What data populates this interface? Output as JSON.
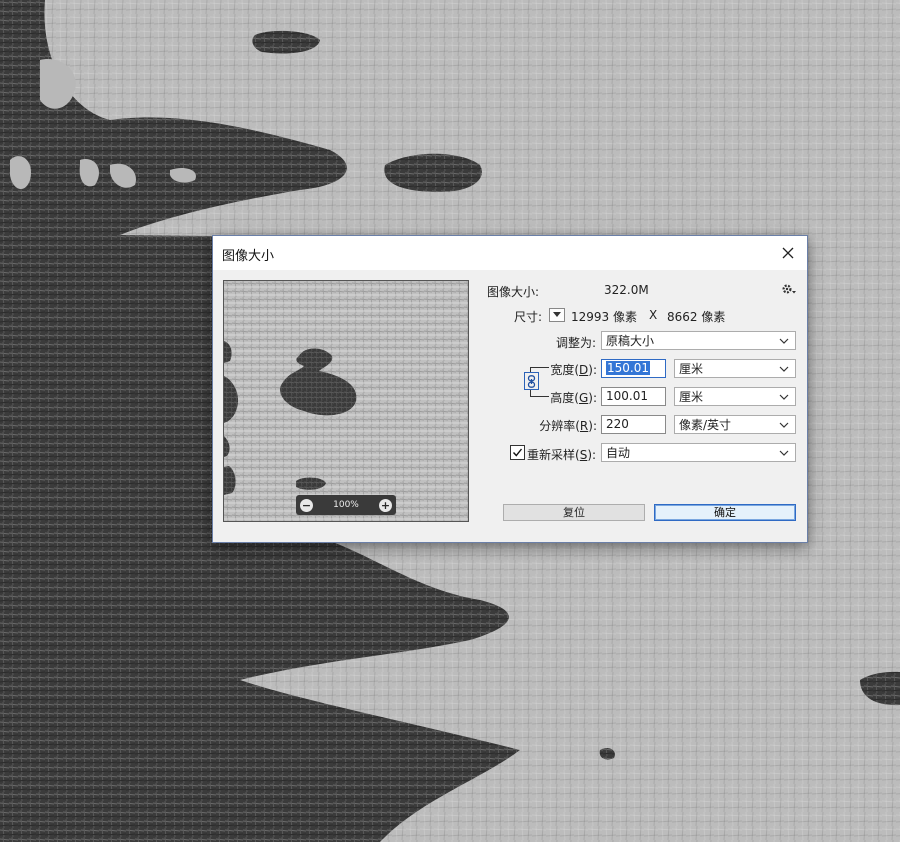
{
  "dialog": {
    "title": "图像大小",
    "close_icon": "close-icon"
  },
  "preview": {
    "zoom_level": "100%",
    "zoom_out_icon": "minus-icon",
    "zoom_in_icon": "plus-icon"
  },
  "info": {
    "image_size_label": "图像大小:",
    "image_size_value": "322.0M",
    "dimensions_label": "尺寸:",
    "dimensions_width": "12993 像素",
    "dimensions_x": "X",
    "dimensions_height": "8662 像素",
    "settings_icon": "gear-icon"
  },
  "fit_to": {
    "label": "调整为:",
    "value": "原稿大小"
  },
  "width": {
    "label_main": "宽度(",
    "label_key": "D",
    "label_end": "):",
    "value": "150.01",
    "unit": "厘米"
  },
  "height": {
    "label_main": "高度(",
    "label_key": "G",
    "label_end": "):",
    "value": "100.01",
    "unit": "厘米"
  },
  "resolution": {
    "label_main": "分辨率(",
    "label_key": "R",
    "label_end": "):",
    "value": "220",
    "unit": "像素/英寸"
  },
  "resample": {
    "checked": true,
    "label_main": "重新采样(",
    "label_key": "S",
    "label_end": "):",
    "value": "自动"
  },
  "buttons": {
    "reset": "复位",
    "ok": "确定"
  },
  "colors": {
    "accent": "#2f6ac4",
    "selection": "#3476d6",
    "canvas_dark": "#3a3a3a",
    "canvas_light": "#bdbdbd"
  }
}
